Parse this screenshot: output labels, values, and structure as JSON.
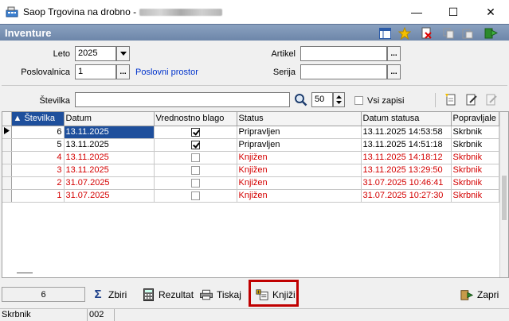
{
  "window": {
    "title": "Saop Trgovina na drobno - ",
    "app_icon": "cash-register-icon",
    "min_label": "—",
    "max_label": "☐",
    "close_label": "✕"
  },
  "header": {
    "title": "Inventure",
    "tools": [
      "layout-icon",
      "star-icon",
      "delete-doc-icon",
      "copy-disabled-icon",
      "paste-disabled-icon",
      "exit-icon"
    ]
  },
  "filters": {
    "leto_label": "Leto",
    "leto_value": "2025",
    "poslovalnica_label": "Poslovalnica",
    "poslovalnica_value": "1",
    "poslovalnica_link": "Poslovni prostor",
    "artikel_label": "Artikel",
    "artikel_value": "",
    "serija_label": "Serija",
    "serija_value": "",
    "stevilka_label": "Številka",
    "stevilka_value": "",
    "limit_value": "50",
    "vsi_zapisi_label": "Vsi zapisi",
    "vsi_zapisi_checked": false,
    "dots": "..."
  },
  "grid": {
    "columns": [
      "Številka",
      "Datum",
      "Vrednostno blago",
      "Status",
      "Datum statusa",
      "Popravljale"
    ],
    "rows": [
      {
        "stevilka": "6",
        "datum": "13.11.2025",
        "vrednostno": true,
        "status": "Pripravljen",
        "datum_statusa": "13.11.2025 14:53:58",
        "popravljal": "Skrbnik",
        "red": false
      },
      {
        "stevilka": "5",
        "datum": "13.11.2025",
        "vrednostno": true,
        "status": "Pripravljen",
        "datum_statusa": "13.11.2025 14:51:18",
        "popravljal": "Skrbnik",
        "red": false
      },
      {
        "stevilka": "4",
        "datum": "13.11.2025",
        "vrednostno": false,
        "status": "Knjižen",
        "datum_statusa": "13.11.2025 14:18:12",
        "popravljal": "Skrbnik",
        "red": true
      },
      {
        "stevilka": "3",
        "datum": "13.11.2025",
        "vrednostno": false,
        "status": "Knjižen",
        "datum_statusa": "13.11.2025 13:29:50",
        "popravljal": "Skrbnik",
        "red": true
      },
      {
        "stevilka": "2",
        "datum": "31.07.2025",
        "vrednostno": false,
        "status": "Knjižen",
        "datum_statusa": "31.07.2025 10:46:41",
        "popravljal": "Skrbnik",
        "red": true
      },
      {
        "stevilka": "1",
        "datum": "31.07.2025",
        "vrednostno": false,
        "status": "Knjižen",
        "datum_statusa": "31.07.2025 10:27:30",
        "popravljal": "Skrbnik",
        "red": true
      }
    ],
    "selected_row": 0,
    "colors": {
      "selection": "#1e4f9c",
      "posted": "#d40000"
    }
  },
  "footer": {
    "count": "6",
    "zbiri": "Zbiri",
    "rezultat": "Rezultat",
    "tiskaj": "Tiskaj",
    "knjizi": "Knjiži",
    "zapri": "Zapri"
  },
  "status": {
    "user": "Skrbnik",
    "code": "002"
  }
}
